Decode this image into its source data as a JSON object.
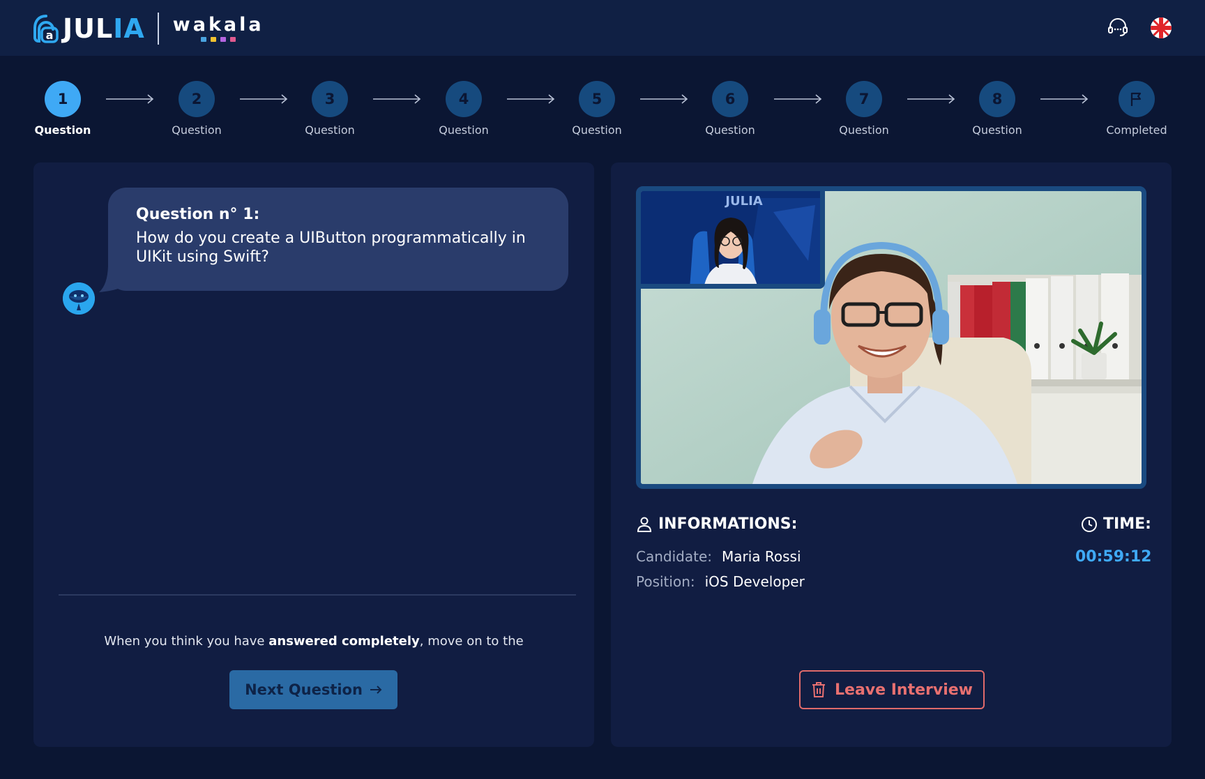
{
  "header": {
    "brand_part1": "JUL",
    "brand_part2": "IA",
    "partner": "wakala",
    "partner_dot_colors": [
      "#3fa9f5",
      "#f5c842",
      "#b565e0",
      "#e05a8f"
    ],
    "accent_color": "#2fa8f0"
  },
  "stepper": {
    "steps": [
      {
        "num": "1",
        "label": "Question",
        "active": true
      },
      {
        "num": "2",
        "label": "Question"
      },
      {
        "num": "3",
        "label": "Question"
      },
      {
        "num": "4",
        "label": "Question"
      },
      {
        "num": "5",
        "label": "Question"
      },
      {
        "num": "6",
        "label": "Question"
      },
      {
        "num": "7",
        "label": "Question"
      },
      {
        "num": "8",
        "label": "Question"
      },
      {
        "num": "",
        "label": "Completed",
        "icon": "flag-icon"
      }
    ]
  },
  "question": {
    "title": "Question n° 1:",
    "text": "How do you create a UIButton programmatically in UIKit using Swift?"
  },
  "hint": {
    "before": "When you think you have ",
    "bold": "answered completely",
    "after": ", move on to the"
  },
  "next_button": {
    "label": "Next Question"
  },
  "video": {
    "pip_brand": "JULIA"
  },
  "info": {
    "heading": "INFORMATIONS:",
    "candidate_label": "Candidate:",
    "candidate_value": "Maria Rossi",
    "position_label": "Position:",
    "position_value": "iOS Developer"
  },
  "time": {
    "heading": "TIME:",
    "value": "00:59:12"
  },
  "leave_button": {
    "label": "Leave Interview"
  },
  "colors": {
    "background": "#0b1633",
    "panel": "#111d42",
    "step_active": "#3fa9f5",
    "step_inactive": "#164a7e",
    "danger": "#e06a6a"
  }
}
